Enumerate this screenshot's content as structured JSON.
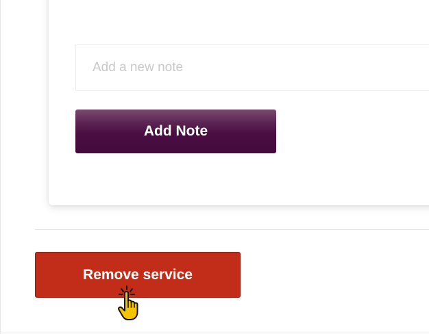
{
  "notes": {
    "input_placeholder": "Add a new note",
    "input_value": "",
    "add_button_label": "Add Note",
    "add_button_color": "#4a0e42"
  },
  "service": {
    "remove_button_label": "Remove service",
    "remove_button_color": "#c12d18"
  },
  "cursor": {
    "icon": "hand-pointer-click-icon"
  }
}
